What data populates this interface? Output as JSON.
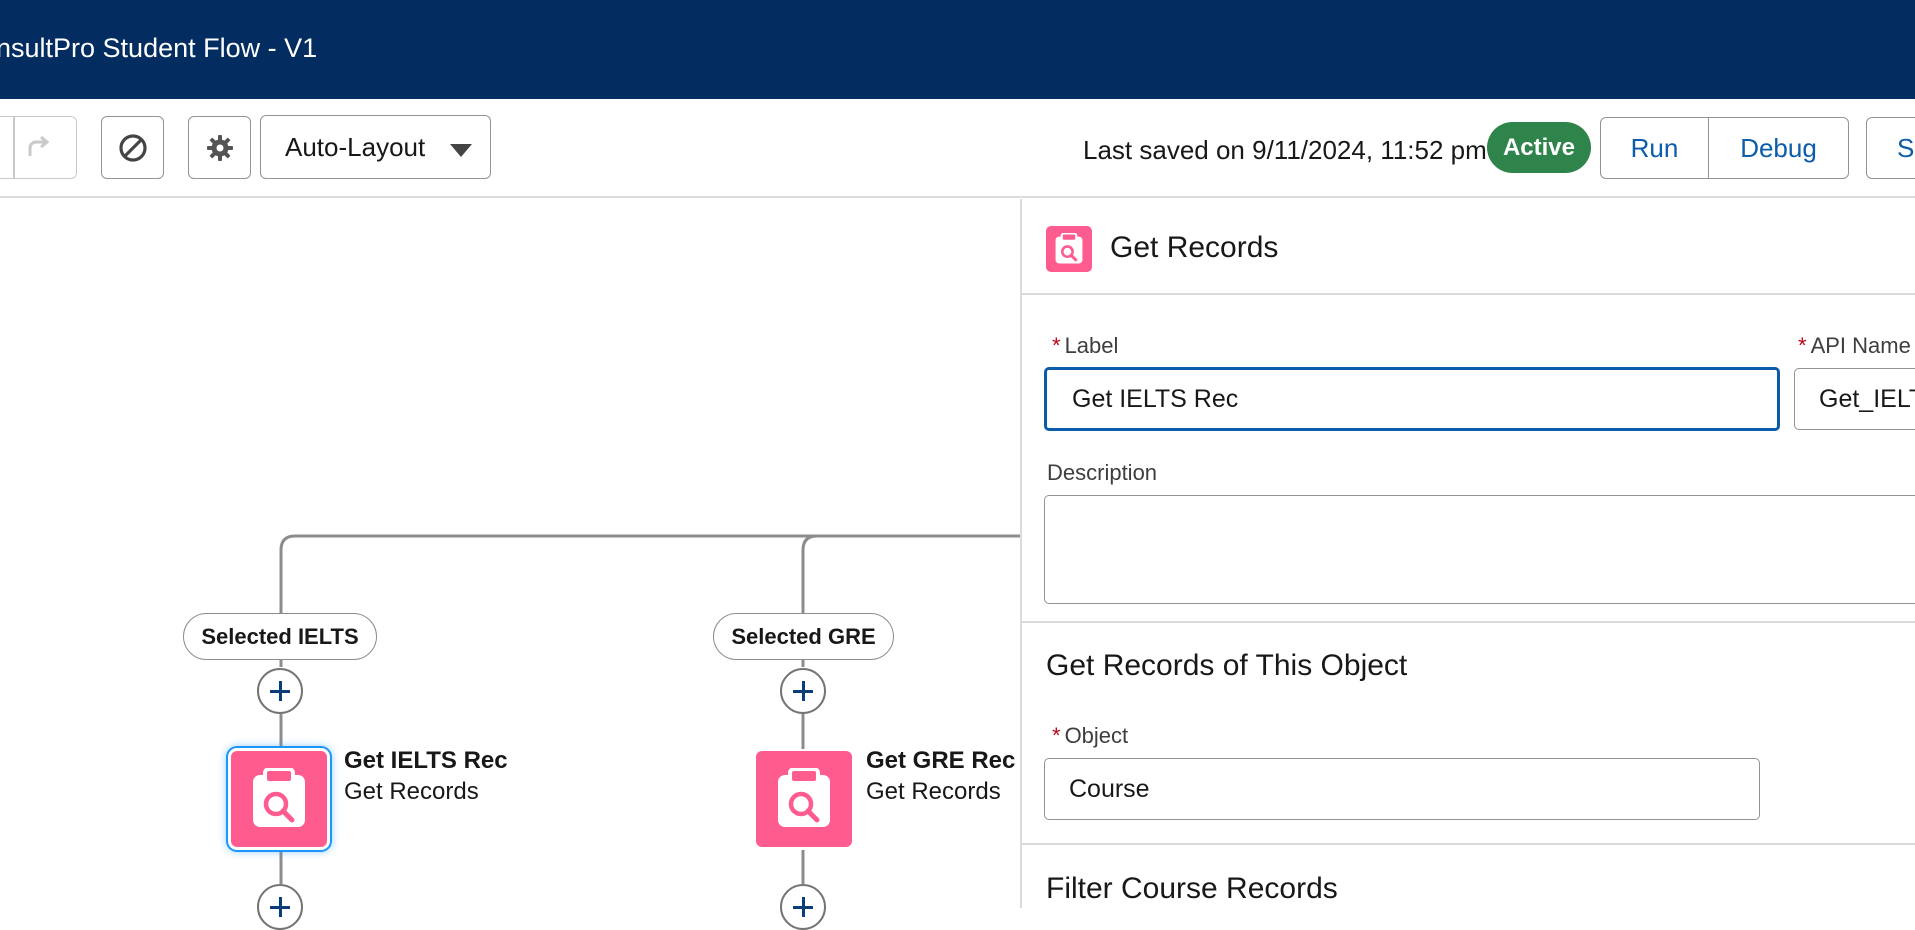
{
  "header": {
    "title": "nsultPro Student Flow - V1"
  },
  "toolbar": {
    "layout_mode": "Auto-Layout",
    "last_saved": "Last saved on 9/11/2024, 11:52 pm",
    "status": "Active",
    "run_label": "Run",
    "debug_label": "Debug",
    "save_label": "Sa"
  },
  "canvas": {
    "branches": [
      {
        "label": "Selected IELTS",
        "node_title": "Get IELTS Rec",
        "node_type": "Get Records",
        "selected": true
      },
      {
        "label": "Selected GRE",
        "node_title": "Get GRE Rec",
        "node_type": "Get Records",
        "selected": false
      }
    ]
  },
  "panel": {
    "title": "Get Records",
    "label_field": {
      "label": "Label",
      "value": "Get IELTS Rec"
    },
    "api_name_field": {
      "label": "API Name",
      "value": "Get_IELTS"
    },
    "description_field": {
      "label": "Description",
      "value": ""
    },
    "object_section": {
      "title": "Get Records of This Object",
      "object_label": "Object",
      "object_value": "Course"
    },
    "filter_section": {
      "title": "Filter Course Records"
    }
  },
  "colors": {
    "header_bg": "#032d60",
    "accent_blue": "#0b5cab",
    "active_green": "#2e844a",
    "get_records_pink": "#fe5c8f",
    "required_red": "#ba0517"
  },
  "icons": [
    "redo-icon",
    "disable-icon",
    "gear-icon",
    "caret-down-icon",
    "add-icon",
    "get-records-icon"
  ]
}
